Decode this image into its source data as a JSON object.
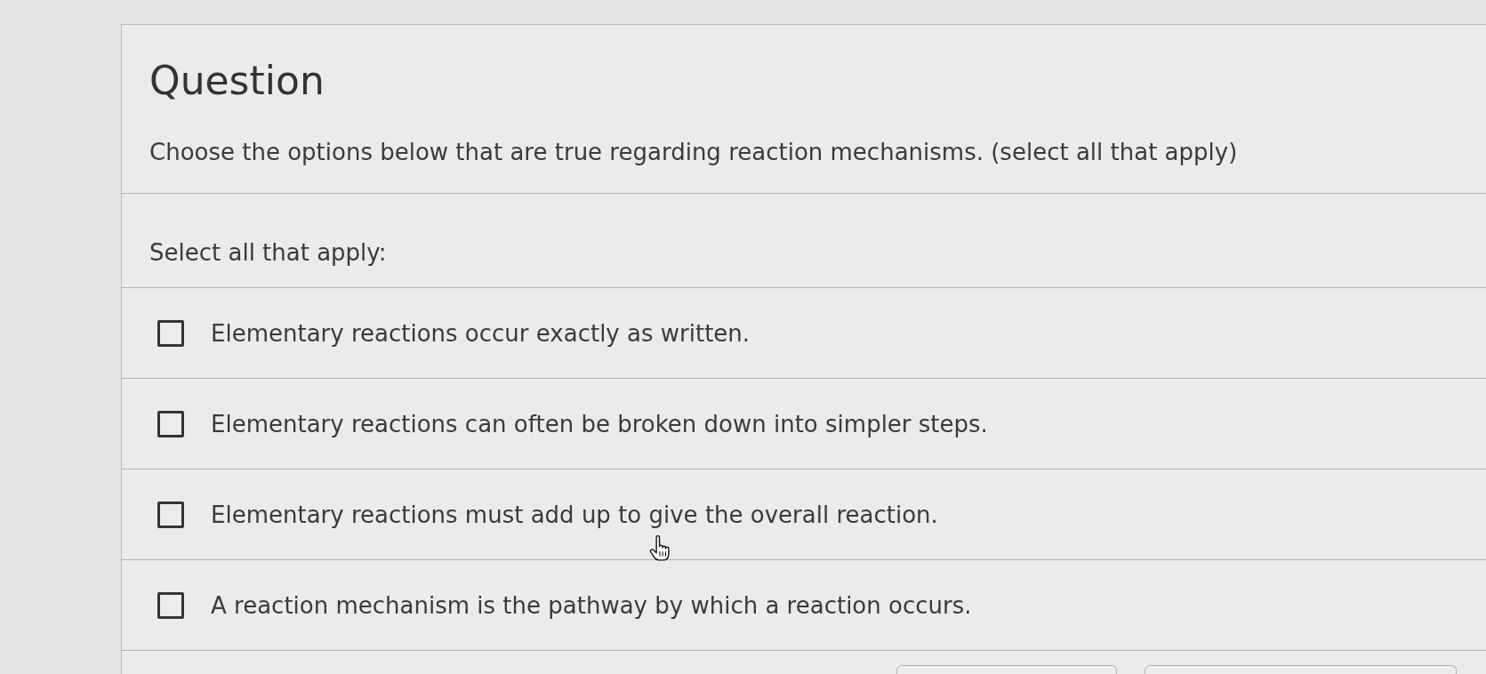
{
  "question": {
    "title": "Question",
    "prompt": "Choose the options below that are true regarding reaction mechanisms. (select all that apply)",
    "instruction": "Select all that apply:",
    "options": [
      {
        "label": "Elementary reactions occur exactly as written.",
        "checked": false
      },
      {
        "label": "Elementary reactions can often be broken down into simpler steps.",
        "checked": false
      },
      {
        "label": "Elementary reactions must add up to give the overall reaction.",
        "checked": false
      },
      {
        "label": "A reaction mechanism is the pathway by which a reaction occurs.",
        "checked": false
      }
    ]
  }
}
